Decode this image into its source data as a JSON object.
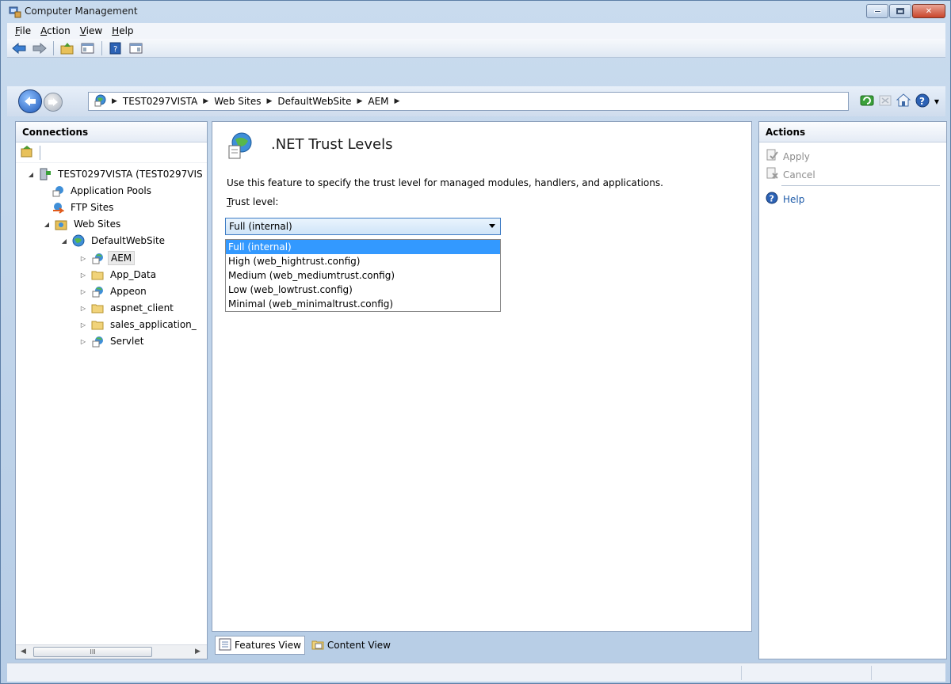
{
  "window": {
    "title": "Computer Management"
  },
  "menu": [
    {
      "label": "File",
      "hot": "F",
      "rest": "ile"
    },
    {
      "label": "Action",
      "hot": "A",
      "rest": "ction"
    },
    {
      "label": "View",
      "hot": "V",
      "rest": "iew"
    },
    {
      "label": "Help",
      "hot": "H",
      "rest": "elp"
    }
  ],
  "address": {
    "crumbs": [
      "TEST0297VISTA",
      "Web Sites",
      "DefaultWebSite",
      "AEM"
    ]
  },
  "connections": {
    "header": "Connections",
    "tree": [
      {
        "label": "TEST0297VISTA (TEST0297VIS"
      },
      {
        "label": "Application Pools"
      },
      {
        "label": "FTP Sites"
      },
      {
        "label": "Web Sites"
      },
      {
        "label": "DefaultWebSite"
      },
      {
        "label": "AEM"
      },
      {
        "label": "App_Data"
      },
      {
        "label": "Appeon"
      },
      {
        "label": "aspnet_client"
      },
      {
        "label": "sales_application_"
      },
      {
        "label": "Servlet"
      }
    ],
    "scroll_thumb": "III"
  },
  "content": {
    "title": ".NET Trust Levels",
    "description": "Use this feature to specify the trust level for managed modules, handlers, and applications.",
    "trust_label_hot": "T",
    "trust_label_rest": "rust level:",
    "selected_value": "Full (internal)",
    "options": [
      "Full (internal)",
      "High (web_hightrust.config)",
      "Medium (web_mediumtrust.config)",
      "Low (web_lowtrust.config)",
      "Minimal (web_minimaltrust.config)"
    ]
  },
  "views": {
    "features": "Features View",
    "content": "Content View"
  },
  "actions": {
    "header": "Actions",
    "apply": "Apply",
    "cancel": "Cancel",
    "help": "Help"
  },
  "colors": {
    "selection": "#3399ff",
    "link": "#1c5aa8",
    "disabled": "#8c8c8c"
  }
}
